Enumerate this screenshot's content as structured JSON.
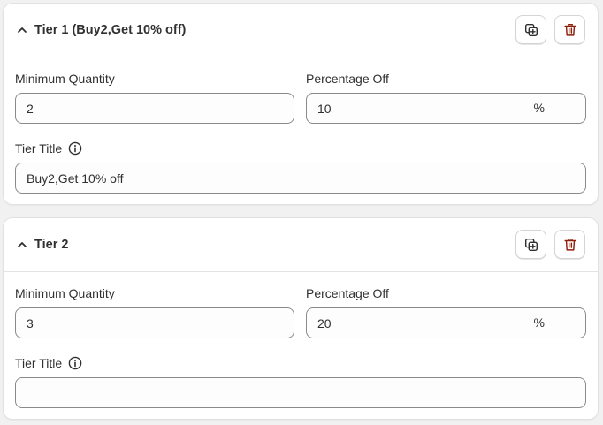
{
  "tiers": [
    {
      "name": "Tier 1 (Buy2,Get 10% off)",
      "min_qty_label": "Minimum Quantity",
      "min_qty_value": "2",
      "pct_label": "Percentage Off",
      "pct_value": "10",
      "pct_suffix": "%",
      "title_label": "Tier Title",
      "title_value": "Buy2,Get 10% off"
    },
    {
      "name": "Tier 2",
      "min_qty_label": "Minimum Quantity",
      "min_qty_value": "3",
      "pct_label": "Percentage Off",
      "pct_value": "20",
      "pct_suffix": "%",
      "title_label": "Tier Title",
      "title_value": ""
    }
  ],
  "icons": {
    "collapse": "chevron-up-icon",
    "duplicate": "duplicate-icon",
    "delete": "trash-icon",
    "info": "info-icon"
  },
  "colors": {
    "delete_icon": "#8e1f0b",
    "text": "#303030",
    "field_border": "#8a8a8a"
  }
}
